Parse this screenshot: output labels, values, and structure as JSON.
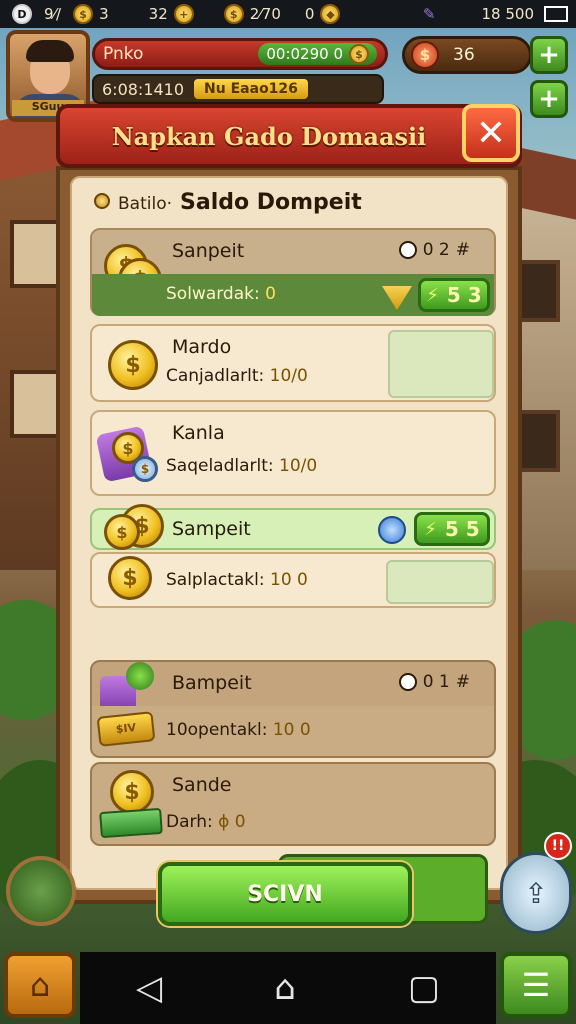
{
  "status_bar": {
    "left_glyph": "D",
    "label_a": "9⁄/",
    "coins_a": "3",
    "value_b": "32",
    "value_c": "2⁄70",
    "value_d": "0",
    "time": "18 500"
  },
  "hud": {
    "avatar_tag": "SGuu",
    "player_name": "Pnko",
    "score": "00:0290 0",
    "timer": "6:08:1410",
    "yellow_label": "Nu Eaao126",
    "money": "36"
  },
  "dialog": {
    "title": "Napkan Gado Domaasii",
    "close_symbol": "✕",
    "subheader_label": "Batilo·",
    "subheader_title": "Saldo Dompeit",
    "rows": [
      {
        "title": "Sanpeit",
        "sub_label": "Solwardak:",
        "sub_value": "0",
        "right_value": "0 2",
        "pill_value": "5 3"
      },
      {
        "title": "Mardo",
        "sub_label": "Canjadlarlt:",
        "sub_value": "10/0"
      },
      {
        "title": "Kanla",
        "sub_label": "Saqeladlarlt:",
        "sub_value": "10/0"
      },
      {
        "title": "Sampeit",
        "pill_value": "5 5"
      },
      {
        "sub_label": "Salplactakl:",
        "sub_value": "10 0"
      },
      {
        "title": "Bampeit",
        "right_value": "0 1"
      },
      {
        "sub_label": "10opentakl:",
        "sub_value": "10 0"
      },
      {
        "title": "Sande",
        "sub_label": "Darh:",
        "sub_value": "ɸ 0"
      }
    ],
    "button_label": "SCIVN"
  },
  "colors": {
    "header_red": "#c53a2a",
    "accent_green": "#5cb63a",
    "gold": "#f0c020",
    "panel_cream": "#f2e3c6"
  },
  "icons": {
    "home": "house-icon",
    "menu": "list-icon",
    "back": "triangle-back-icon",
    "nav_home": "house-outline-icon",
    "recent": "square-icon"
  }
}
